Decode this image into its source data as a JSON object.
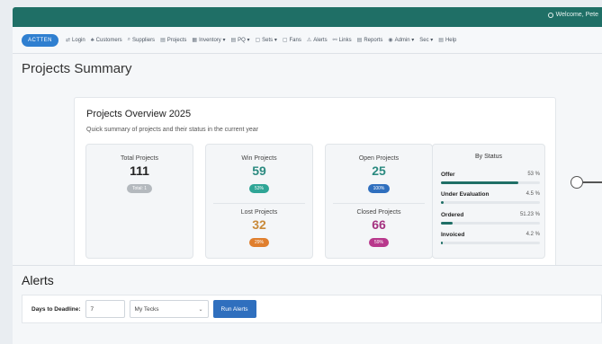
{
  "topbar": {
    "welcome": "Welcome, Pete"
  },
  "nav": {
    "brand": "ACTTEN",
    "items": [
      {
        "icon": "⇄",
        "label": "Login"
      },
      {
        "icon": "♣",
        "label": "Customers"
      },
      {
        "icon": "⌕",
        "label": "Suppliers"
      },
      {
        "icon": "▤",
        "label": "Projects"
      },
      {
        "icon": "▦",
        "label": "Inventory ▾"
      },
      {
        "icon": "▤",
        "label": "PQ ▾"
      },
      {
        "icon": "▢",
        "label": "Sets ▾"
      },
      {
        "icon": "▢",
        "label": "Fans"
      },
      {
        "icon": "⚠",
        "label": "Alerts"
      },
      {
        "icon": "⚯",
        "label": "Links"
      },
      {
        "icon": "▤",
        "label": "Reports"
      },
      {
        "icon": "◉",
        "label": "Admin ▾"
      },
      {
        "icon": "",
        "label": "Sec ▾"
      },
      {
        "icon": "▤",
        "label": "Help"
      }
    ]
  },
  "page": {
    "title": "Projects Summary"
  },
  "overview": {
    "title": "Projects Overview 2025",
    "subtitle": "Quick summary of projects and their status in the current year"
  },
  "stats": {
    "total": {
      "label": "Total Projects",
      "value": "111",
      "pill": "Total: 1",
      "color": "#8a9096",
      "pill_color": "#b4b9be"
    },
    "won": {
      "label": "Win Projects",
      "value": "59",
      "pill": "53%",
      "color": "#2b8a80",
      "pill_color": "#2fa596"
    },
    "lost": {
      "label": "Lost Projects",
      "value": "32",
      "pill": "29%",
      "color": "#c98a3a",
      "pill_color": "#e07f2e"
    },
    "open": {
      "label": "Open Projects",
      "value": "25",
      "pill": "100%",
      "color": "#2b8a80",
      "pill_color": "#2f6fbe"
    },
    "closed": {
      "label": "Closed Projects",
      "value": "66",
      "pill": "59%",
      "color": "#a4317f",
      "pill_color": "#b8388c"
    }
  },
  "by_status": {
    "title": "By Status",
    "rows": [
      {
        "name": "Offer",
        "pct": "53 %",
        "fill": 0.78
      },
      {
        "name": "Under Evaluation",
        "pct": "4.5 %",
        "fill": 0.03
      },
      {
        "name": "Ordered",
        "pct": "51.23 %",
        "fill": 0.12
      },
      {
        "name": "Invoiced",
        "pct": "4.2 %",
        "fill": 0.02
      }
    ]
  },
  "alerts": {
    "title": "Alerts",
    "days_label": "Days to Deadline:",
    "days_value": "7",
    "select_value": "My Tecks",
    "run_label": "Run Alerts"
  },
  "colors": {
    "accent": "#1f6f66",
    "primary": "#2f6fbe"
  }
}
